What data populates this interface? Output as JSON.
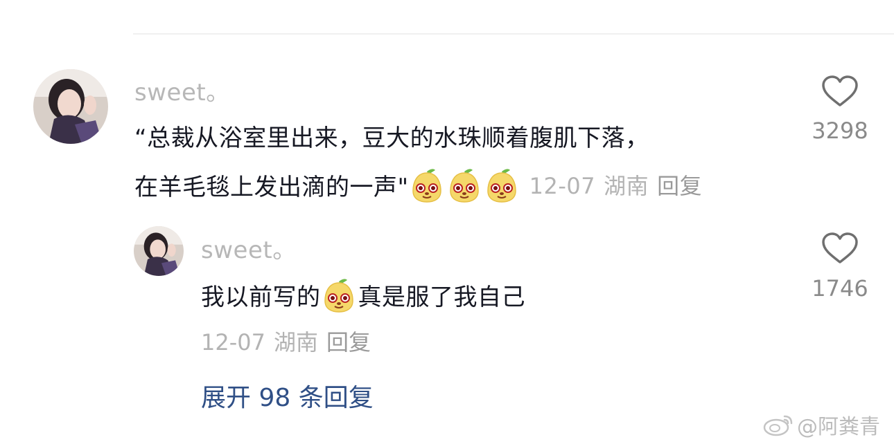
{
  "comment": {
    "username": "sweet。",
    "text_line1": "“总裁从浴室里出来，豆大的水珠顺着腹肌下落，",
    "text_line2": "在羊毛毯上发出滴的一声\"",
    "emoji_name": "grinning-pear-emoji",
    "emoji_count": 3,
    "date": "12-07",
    "location": "湖南",
    "reply_label": "回复",
    "likes": "3298",
    "like_icon": "heart-outline-icon"
  },
  "reply": {
    "username": "sweet。",
    "text_before_emoji": "我以前写的",
    "text_after_emoji": "真是服了我自己",
    "date": "12-07",
    "location": "湖南",
    "reply_label": "回复",
    "likes": "1746",
    "like_icon": "heart-outline-icon"
  },
  "expand_replies": "展开 98 条回复",
  "watermark": {
    "icon": "weibo-logo-icon",
    "text": "@阿粪青"
  },
  "colors": {
    "text_primary": "#161823",
    "text_secondary": "#b3b3b3",
    "link_blue": "#2f4f86",
    "emoji_yellow": "#f5d86a",
    "emoji_leaf": "#6dbb48"
  }
}
